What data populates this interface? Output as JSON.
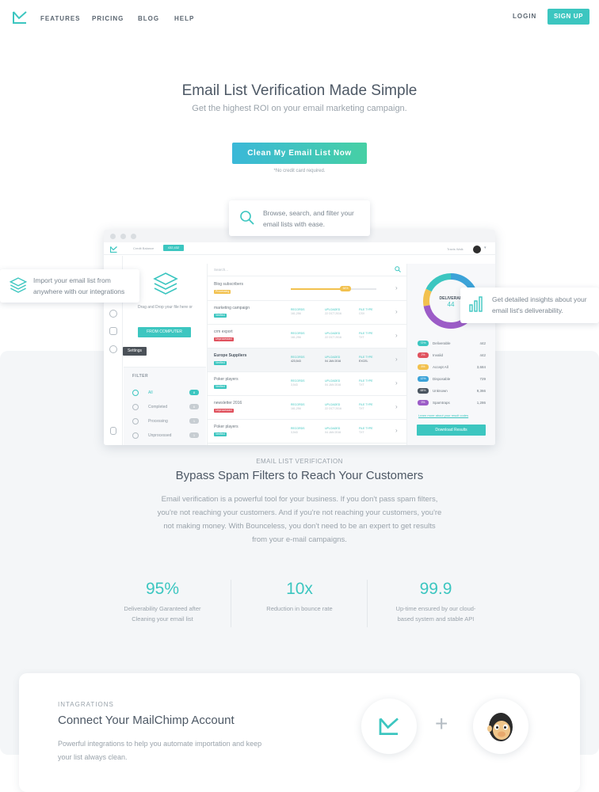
{
  "nav": {
    "links": [
      "FEATURES",
      "PRICING",
      "BLOG",
      "HELP"
    ],
    "login": "LOGIN",
    "signup": "SIGN UP"
  },
  "hero": {
    "title": "Email List Verification Made Simple",
    "subtitle": "Get the highest ROI on your email marketing campaign.",
    "cta": "Clean My Email List Now",
    "note": "*No credit card required."
  },
  "tooltips": {
    "search": "Browse, search, and filter your email lists with ease.",
    "import": "Import your email list from anywhere with our integrations",
    "insights": "Get detailed insights about your email list's deliverability."
  },
  "app": {
    "credit_label": "Credit Balance",
    "credit_value": "432,432",
    "user_name": "Travis Walk",
    "upload_text": "Drag and Drop your file here or",
    "upload_button": "FROM COMPUTER",
    "settings_tip": "Settings",
    "filter": {
      "heading": "FILTER",
      "items": [
        {
          "label": "All",
          "count": "8"
        },
        {
          "label": "Completed",
          "count": "6"
        },
        {
          "label": "Processing",
          "count": "1"
        },
        {
          "label": "Unprocessed",
          "count": "1"
        }
      ]
    },
    "search_placeholder": "Search...",
    "col_labels": [
      "RECORDS",
      "UPLOADED",
      "FILE TYPE"
    ],
    "progress_value": 0.64,
    "progress_label": "64%",
    "lists": [
      {
        "name": "Blog subscribers",
        "badge": "Processing",
        "badge_color": "#f2c14e",
        "records": "",
        "uploaded": "",
        "type": ""
      },
      {
        "name": "marketing campaign",
        "badge": "Verified",
        "badge_color": "#3cc6c0",
        "records": "161,256",
        "uploaded": "22 OCT 2016",
        "type": "CSV"
      },
      {
        "name": "crm export",
        "badge": "Unprocessed",
        "badge_color": "#e0525e",
        "records": "161,256",
        "uploaded": "22 OCT 2016",
        "type": "TXT"
      },
      {
        "name": "Europe Suppliers",
        "badge": "Verified",
        "badge_color": "#3cc6c0",
        "records": "423,543",
        "uploaded": "04 JAN 2016",
        "type": "EXCEL"
      },
      {
        "name": "Poker players",
        "badge": "Verified",
        "badge_color": "#3cc6c0",
        "records": "3,543",
        "uploaded": "04 JAN 2016",
        "type": "TXT"
      },
      {
        "name": "newsletter 2016",
        "badge": "Unprocessed",
        "badge_color": "#e0525e",
        "records": "161,256",
        "uploaded": "22 OCT 2016",
        "type": "TXT"
      },
      {
        "name": "Poker players",
        "badge": "Verified",
        "badge_color": "#3cc6c0",
        "records": "3,543",
        "uploaded": "04 JAN 2016",
        "type": "TXT"
      }
    ],
    "donut_label": "DELIVERAB",
    "donut_value": "44",
    "stats": [
      {
        "pct": "72%",
        "label": "Deliverable",
        "count": "442",
        "color": "#3cc6c0"
      },
      {
        "pct": "2%",
        "label": "Invalid",
        "count": "442",
        "color": "#e0525e"
      },
      {
        "pct": "5%",
        "label": "Accept All",
        "count": "3,684",
        "color": "#f2c14e"
      },
      {
        "pct": "12%",
        "label": "Disposable",
        "count": "729",
        "color": "#3ca3d8"
      },
      {
        "pct": "68%",
        "label": "Unknown",
        "count": "9,366",
        "color": "#4b5560"
      },
      {
        "pct": "9%",
        "label": "Spamtraps",
        "count": "1,286",
        "color": "#9c5cc7"
      }
    ],
    "learn_more": "Learn more about your result codes",
    "download": "Download Results"
  },
  "features": {
    "eyebrow": "EMAIL LIST VERIFICATION",
    "title": "Bypass Spam Filters to Reach Your Customers",
    "body": "Email verification is a powerful tool for your business. If you don't pass spam filters, you're not reaching your customers. And if you're not reaching your customers, you're not making money. With Bounceless, you don't need to be an expert to get results from your e-mail campaigns.",
    "metrics": [
      {
        "value": "95%",
        "caption": "Deliverability Garanteed after Cleaning your email list"
      },
      {
        "value": "10x",
        "caption": "Reduction in bounce rate"
      },
      {
        "value": "99.9",
        "caption": "Up-time ensured by our cloud-based system and stable API"
      }
    ]
  },
  "integration": {
    "eyebrow": "INTAGRATIONS",
    "title": "Connect Your MailChimp Account",
    "body": "Powerful integrations to help you automate importation and keep your list always clean.",
    "plus": "+"
  },
  "colors": {
    "accent": "#3cc6c0",
    "text_dark": "#4d5865",
    "text_muted": "#9aa3ab"
  }
}
